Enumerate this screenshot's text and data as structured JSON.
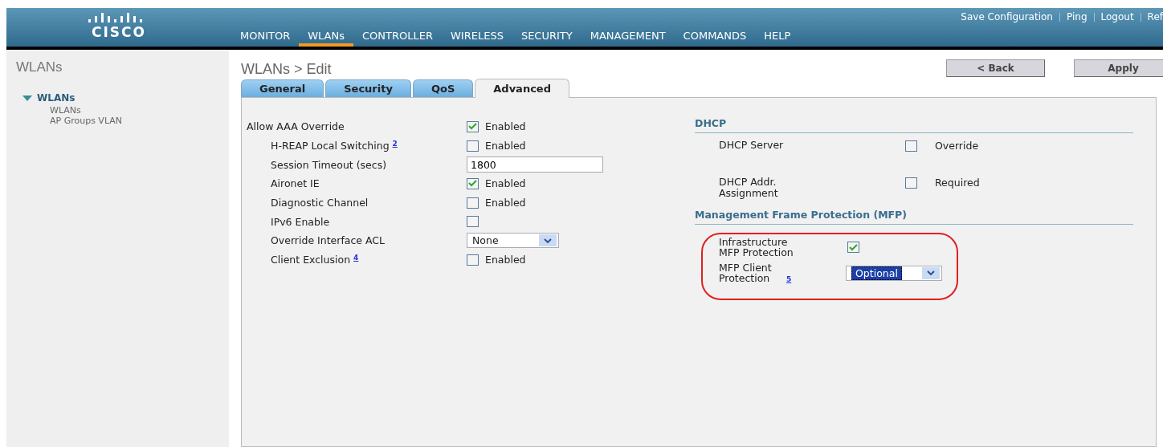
{
  "header": {
    "logo_text": "CISCO",
    "top_links": [
      "Save Configuration",
      "Ping",
      "Logout",
      "Ref"
    ],
    "nav": [
      {
        "label": "MONITOR",
        "selected": false
      },
      {
        "label": "WLANs",
        "selected": true
      },
      {
        "label": "CONTROLLER",
        "selected": false
      },
      {
        "label": "WIRELESS",
        "selected": false
      },
      {
        "label": "SECURITY",
        "selected": false
      },
      {
        "label": "MANAGEMENT",
        "selected": false
      },
      {
        "label": "COMMANDS",
        "selected": false
      },
      {
        "label": "HELP",
        "selected": false
      }
    ]
  },
  "sidebar": {
    "title": "WLANs",
    "section": {
      "label": "WLANs",
      "expanded": true,
      "children": [
        {
          "label": "WLANs"
        },
        {
          "label": "AP Groups VLAN"
        }
      ]
    }
  },
  "page_title": "WLANs > Edit",
  "buttons": [
    "< Back",
    "Apply"
  ],
  "tabs": [
    {
      "label": "General",
      "selected": false
    },
    {
      "label": "Security",
      "selected": false
    },
    {
      "label": "QoS",
      "selected": false
    },
    {
      "label": "Advanced",
      "selected": true
    }
  ],
  "left_rows": [
    {
      "kind": "checkbox",
      "label": "Allow AAA Override",
      "indented": false,
      "checked": true,
      "option": "Enabled"
    },
    {
      "kind": "checkbox",
      "label": "H-REAP Local Switching",
      "note": "2",
      "indented": true,
      "checked": false,
      "option": "Enabled"
    },
    {
      "kind": "text",
      "label": "Session Timeout (secs)",
      "indented": true,
      "value": "1800"
    },
    {
      "kind": "checkbox",
      "label": "Aironet IE",
      "indented": true,
      "checked": true,
      "option": "Enabled"
    },
    {
      "kind": "checkbox",
      "label": "Diagnostic Channel",
      "indented": true,
      "checked": false,
      "option": "Enabled"
    },
    {
      "kind": "checkbox",
      "label": "IPv6 Enable",
      "indented": true,
      "checked": false
    },
    {
      "kind": "select",
      "label": "Override Interface ACL",
      "indented": true,
      "value": "None"
    },
    {
      "kind": "checkbox",
      "label": "Client Exclusion",
      "note": "4",
      "indented": true,
      "checked": false,
      "option": "Enabled"
    }
  ],
  "dhcp": {
    "title": "DHCP",
    "rows": [
      {
        "kind": "checkbox",
        "label": "DHCP Server",
        "checked": false,
        "option": "Override"
      },
      {
        "kind": "checkbox",
        "label": "DHCP Addr. Assignment",
        "checked": false,
        "option": "Required"
      }
    ]
  },
  "mfp": {
    "title": "Management Frame Protection (MFP)",
    "rows": [
      {
        "kind": "checkbox",
        "label": "Infrastructure MFP Protection",
        "checked": true
      },
      {
        "kind": "select",
        "label": "MFP Client Protection",
        "note": "5",
        "value": "Optional"
      }
    ]
  }
}
